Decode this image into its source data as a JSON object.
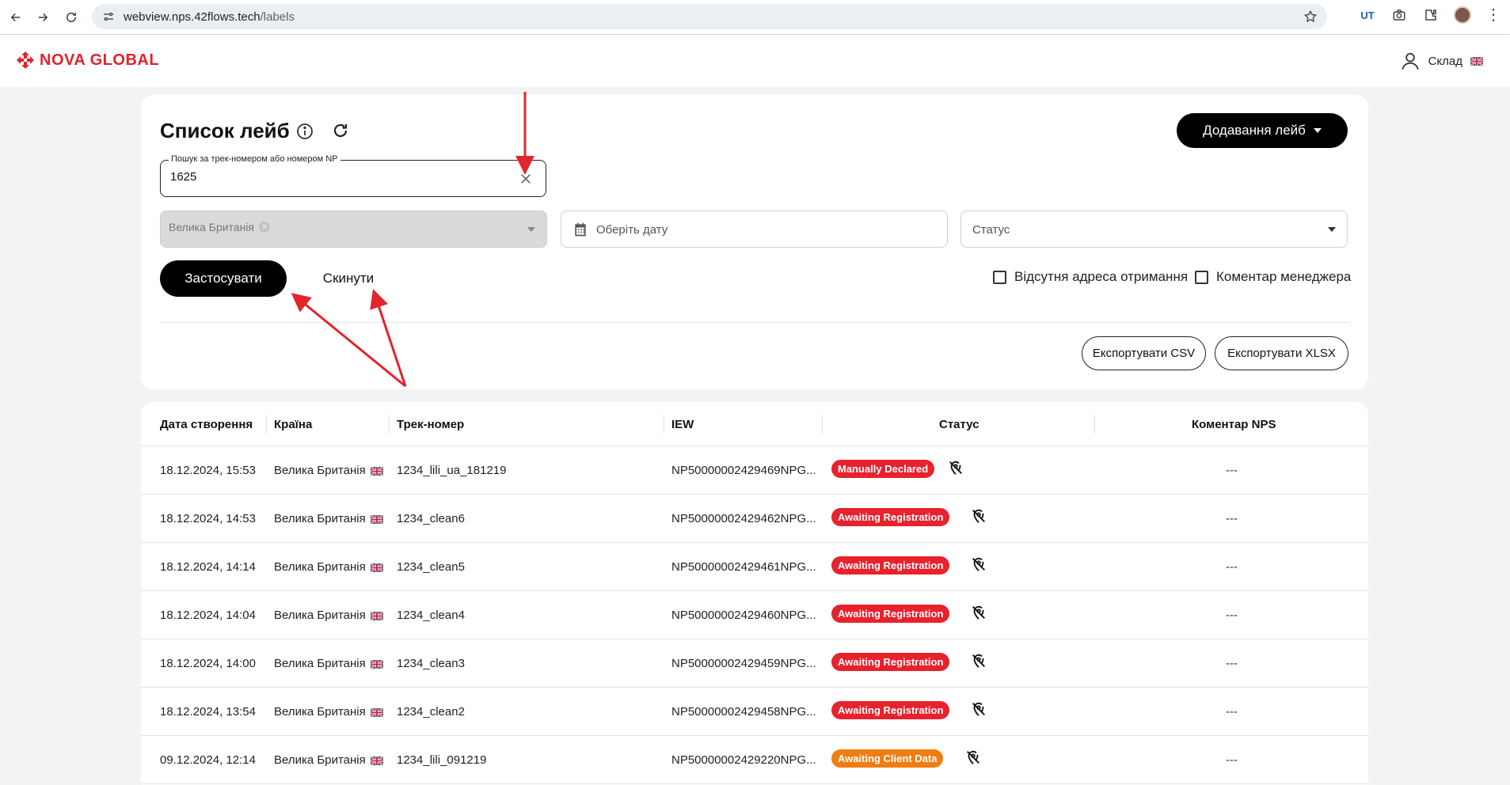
{
  "browser": {
    "url_host": "webview.nps.42flows.tech",
    "url_path": "/labels",
    "ext_label": "UT"
  },
  "header": {
    "logo_text": "NOVA GLOBAL",
    "user_label": "Склад"
  },
  "filters": {
    "title": "Список лейб",
    "add_button_label": "Додавання лейб",
    "search_label": "Пошук за трек-номером або номером NP",
    "search_value": "1625",
    "country_chip": "Велика Британія",
    "date_placeholder": "Оберіть дату",
    "status_placeholder": "Статус",
    "apply_label": "Застосувати",
    "reset_label": "Скинути",
    "check_missing_address": "Відсутня адреса отримання",
    "check_manager_comment": "Коментар менеджера",
    "export_csv": "Експортувати CSV",
    "export_xlsx": "Експортувати XLSX"
  },
  "table": {
    "columns": [
      "Дата створення",
      "Країна",
      "Трек-номер",
      "IEW",
      "Статус",
      "Коментар NPS"
    ],
    "rows": [
      {
        "date": "18.12.2024, 15:53",
        "country": "Велика Британія",
        "track": "1234_lili_ua_181219",
        "iew": "NP50000002429469NPG...",
        "status": "Manually Declared",
        "comment": "---"
      },
      {
        "date": "18.12.2024, 14:53",
        "country": "Велика Британія",
        "track": "1234_clean6",
        "iew": "NP50000002429462NPG...",
        "status": "Awaiting Registration",
        "comment": "---"
      },
      {
        "date": "18.12.2024, 14:14",
        "country": "Велика Британія",
        "track": "1234_clean5",
        "iew": "NP50000002429461NPG...",
        "status": "Awaiting Registration",
        "comment": "---"
      },
      {
        "date": "18.12.2024, 14:04",
        "country": "Велика Британія",
        "track": "1234_clean4",
        "iew": "NP50000002429460NPG...",
        "status": "Awaiting Registration",
        "comment": "---"
      },
      {
        "date": "18.12.2024, 14:00",
        "country": "Велика Британія",
        "track": "1234_clean3",
        "iew": "NP50000002429459NPG...",
        "status": "Awaiting Registration",
        "comment": "---"
      },
      {
        "date": "18.12.2024, 13:54",
        "country": "Велика Британія",
        "track": "1234_clean2",
        "iew": "NP50000002429458NPG...",
        "status": "Awaiting Registration",
        "comment": "---"
      },
      {
        "date": "09.12.2024, 12:14",
        "country": "Велика Британія",
        "track": "1234_lili_091219",
        "iew": "NP50000002429220NPG...",
        "status": "Awaiting Client Data",
        "comment": "---"
      }
    ]
  },
  "colors": {
    "brand_red": "#e0232e",
    "badge_red": "#e8222d",
    "badge_orange": "#f07d10",
    "annotation_red": "#e3242b"
  }
}
